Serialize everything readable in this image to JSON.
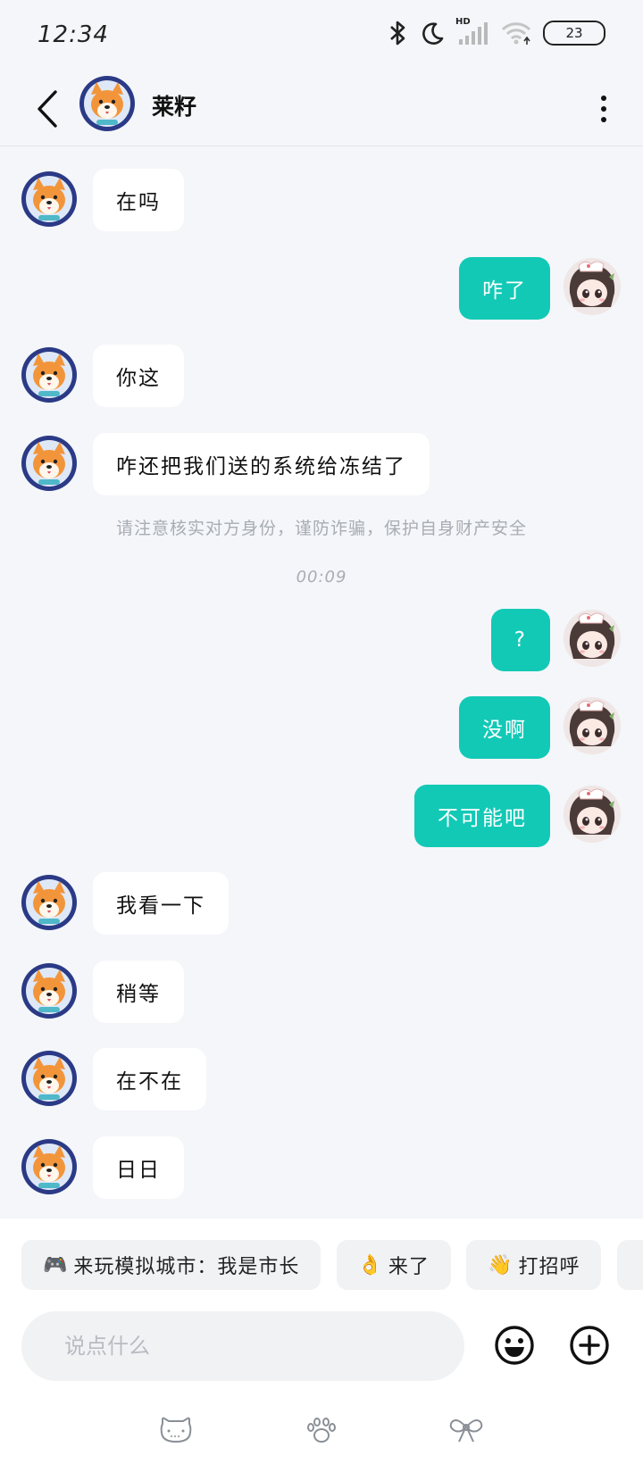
{
  "status_bar": {
    "time": "12:34",
    "battery": "23",
    "network": "HD",
    "icons": [
      "bluetooth-icon",
      "do-not-disturb-moon-icon",
      "hd-signal-icon",
      "wifi-icon",
      "battery-icon"
    ]
  },
  "header": {
    "contact_name": "莱籽",
    "back_icon": "chevron-left-icon",
    "more_icon": "more-vertical-icon"
  },
  "messages": [
    {
      "side": "left",
      "text": "在吗"
    },
    {
      "side": "right",
      "text": "咋了"
    },
    {
      "side": "left",
      "text": "你这"
    },
    {
      "side": "left",
      "text": "咋还把我们送的系统给冻结了"
    },
    {
      "side": "right",
      "text": "?"
    },
    {
      "side": "right",
      "text": "没啊"
    },
    {
      "side": "right",
      "text": "不可能吧"
    },
    {
      "side": "left",
      "text": "我看一下"
    },
    {
      "side": "left",
      "text": "稍等"
    },
    {
      "side": "left",
      "text": "在不在"
    },
    {
      "side": "left",
      "text": "日日"
    }
  ],
  "notice": "请注意核实对方身份，谨防诈骗，保护自身财产安全",
  "timestamp": "00:09",
  "quick_replies": [
    {
      "emoji": "🎮",
      "label": "来玩模拟城市：我是市长"
    },
    {
      "emoji": "👌",
      "label": "来了"
    },
    {
      "emoji": "👋",
      "label": "打招呼"
    }
  ],
  "input": {
    "placeholder": "说点什么"
  },
  "bottom_icons": [
    "cat-face-icon",
    "paw-icon",
    "bow-icon"
  ],
  "colors": {
    "accent": "#12c9b6",
    "background": "#f4f6f9"
  }
}
